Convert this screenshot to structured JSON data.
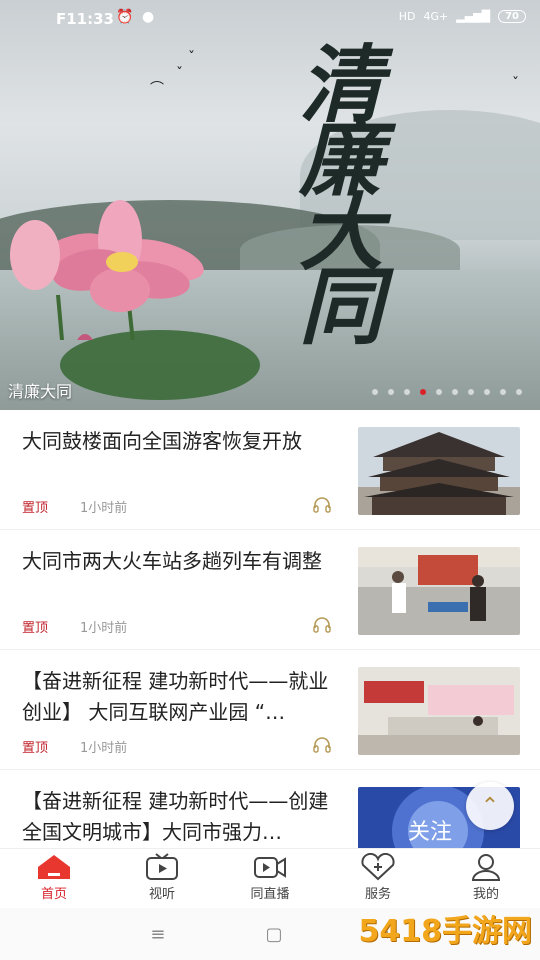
{
  "status_bar": {
    "time": "F11:33",
    "network": "4G+",
    "battery": "70"
  },
  "banner": {
    "big_title": [
      "清",
      "廉",
      "大",
      "同"
    ],
    "caption": "清廉大同",
    "dot_count": 10,
    "active_dot": 3
  },
  "news": [
    {
      "title": "大同鼓楼面向全国游客恢复开放",
      "tag": "置顶",
      "time": "1小时前"
    },
    {
      "title": "大同市两大火车站多趟列车有调整",
      "tag": "置顶",
      "time": "1小时前"
    },
    {
      "title": "【奋进新征程 建功新时代——就业创业】 大同互联网产业园 “…",
      "tag": "置顶",
      "time": "1小时前"
    },
    {
      "title": "【奋进新征程 建功新时代——创建全国文明城市】大同市强力…",
      "tag": "",
      "time": ""
    }
  ],
  "thumb4_text": "关注",
  "tabs": [
    {
      "label": "首页",
      "icon": "home-icon",
      "active": true
    },
    {
      "label": "视听",
      "icon": "tv-icon",
      "active": false
    },
    {
      "label": "同直播",
      "icon": "video-live-icon",
      "active": false
    },
    {
      "label": "服务",
      "icon": "heart-plus-icon",
      "active": false
    },
    {
      "label": "我的",
      "icon": "user-icon",
      "active": false
    }
  ],
  "watermark": "5418手游网",
  "colors": {
    "accent": "#d8222a",
    "tag": "#c0262d"
  }
}
